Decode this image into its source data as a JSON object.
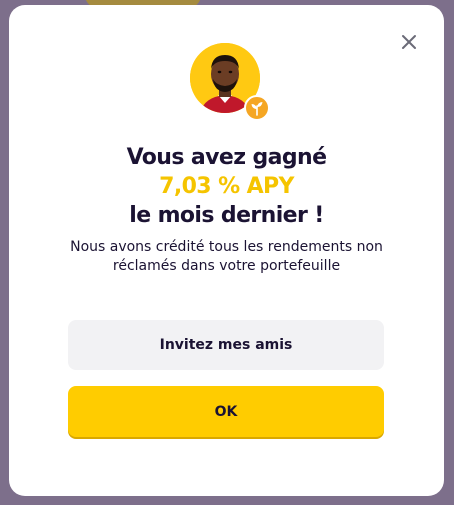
{
  "modal": {
    "close_icon": "close-icon",
    "avatar_icon": "player-avatar",
    "badge_icon": "sprout-icon",
    "headline_line1": "Vous avez gagné",
    "headline_apy": "7,03 % APY",
    "headline_line3": "le mois dernier !",
    "description": "Nous avons crédité tous les rendements non réclamés dans votre portefeuille",
    "invite_button_label": "Invitez mes amis",
    "ok_button_label": "OK"
  },
  "colors": {
    "backdrop": "#7d6f8b",
    "accent_yellow": "#ffcc00",
    "apy_text": "#f5c400",
    "text_dark": "#1b1333",
    "secondary_button": "#f2f2f4",
    "badge_orange": "#f5a623"
  }
}
